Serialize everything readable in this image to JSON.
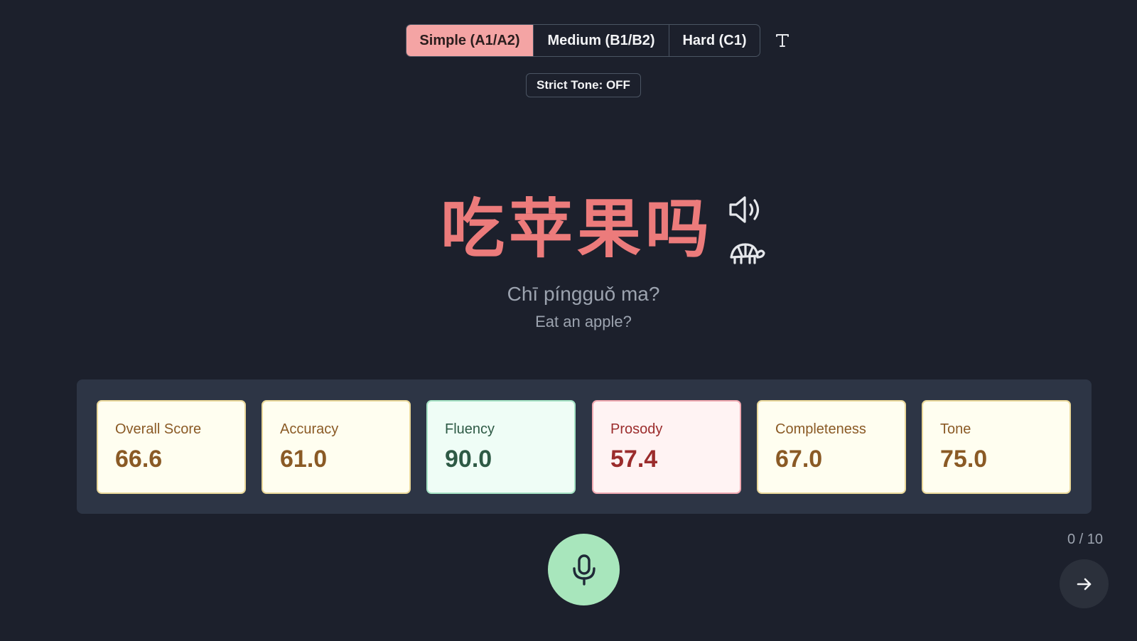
{
  "difficulty": {
    "options": [
      "Simple (A1/A2)",
      "Medium (B1/B2)",
      "Hard (C1)"
    ],
    "selected": "Simple (A1/A2)"
  },
  "strict_tone_label": "Strict Tone: OFF",
  "sentence": {
    "hanzi": "吃苹果吗",
    "pinyin": "Chī píngguǒ ma?",
    "translation": "Eat an apple?"
  },
  "scores": [
    {
      "label": "Overall Score",
      "value": "66.6",
      "status": "medium"
    },
    {
      "label": "Accuracy",
      "value": "61.0",
      "status": "medium"
    },
    {
      "label": "Fluency",
      "value": "90.0",
      "status": "good"
    },
    {
      "label": "Prosody",
      "value": "57.4",
      "status": "bad"
    },
    {
      "label": "Completeness",
      "value": "67.0",
      "status": "medium"
    },
    {
      "label": "Tone",
      "value": "75.0",
      "status": "medium"
    }
  ],
  "progress_text": "0 / 10",
  "icons": {
    "font_toggle": "text-type-icon",
    "play_audio": "speaker-icon",
    "play_slow": "turtle-icon",
    "record": "microphone-icon",
    "next": "arrow-right-icon"
  },
  "colors": {
    "background": "#1c202c",
    "accent": "#ec7b7b",
    "selected_tab": "#f4a4a4",
    "mic": "#a8e6bc",
    "score_good": "#effdf6",
    "score_medium": "#fffef0",
    "score_bad": "#fff3f3"
  }
}
